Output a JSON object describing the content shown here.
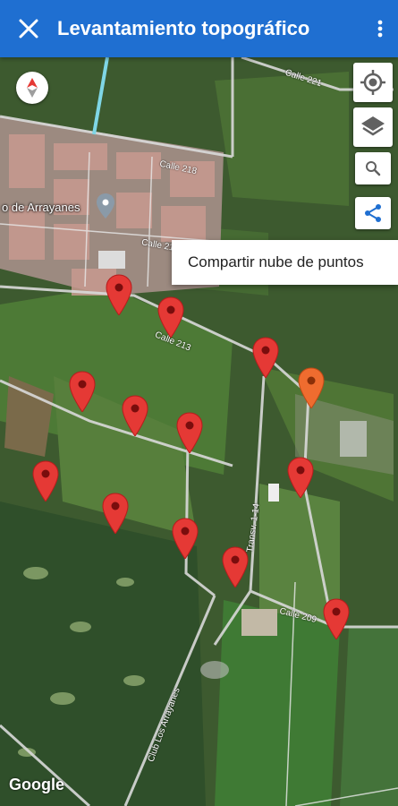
{
  "appbar": {
    "title": "Levantamiento topográfico",
    "close_icon": "close-icon",
    "menu_icon": "more-vert-icon"
  },
  "map": {
    "place_label": "o de Arrayanes",
    "streets": [
      "Calle 221",
      "Calle 218",
      "Calle 215",
      "Calle 213",
      "Calle 209",
      "Transv. 1-14",
      "Club Los Arrayanes"
    ],
    "attribution": "Google"
  },
  "controls": {
    "compass_icon": "compass-icon",
    "locate_icon": "my-location-icon",
    "layers_icon": "layers-icon",
    "search_icon": "search-icon",
    "share_icon": "share-icon"
  },
  "share_menu": {
    "label": "Compartir nube de puntos"
  },
  "markers": {
    "count": 15,
    "selected": 1,
    "colors": {
      "normal": "#e53935",
      "selected": "#ef6c2f"
    }
  },
  "colors": {
    "appbar": "#1f6fd1"
  }
}
